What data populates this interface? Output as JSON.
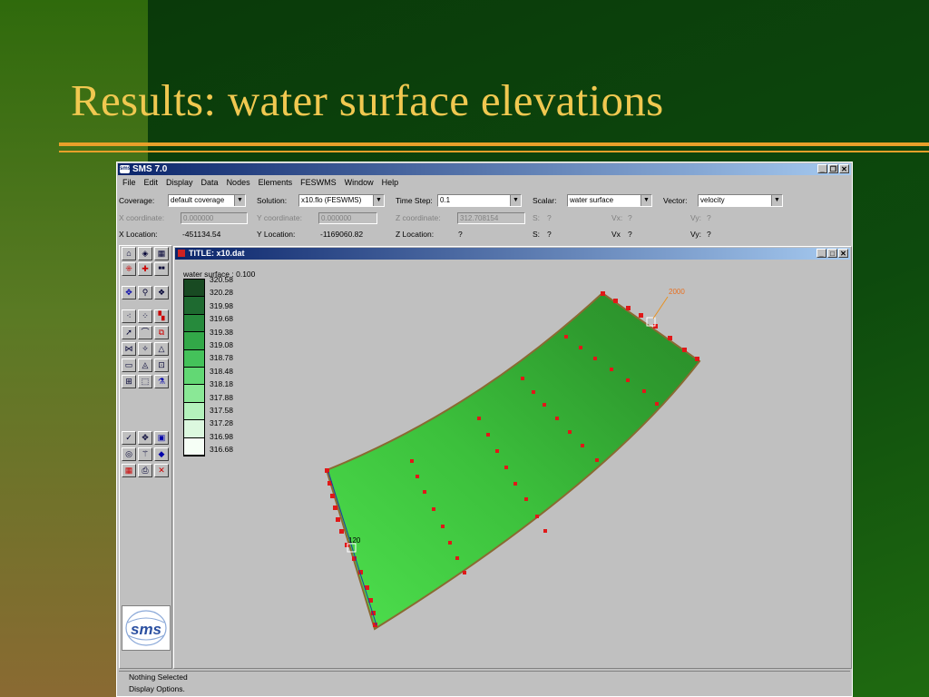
{
  "slide": {
    "title": "Results: water surface elevations"
  },
  "app": {
    "title": "SMS 7.0",
    "menu": [
      "File",
      "Edit",
      "Display",
      "Data",
      "Nodes",
      "Elements",
      "FESWMS",
      "Window",
      "Help"
    ],
    "toolbar": {
      "coverage_label": "Coverage:",
      "coverage_value": "default coverage",
      "solution_label": "Solution:",
      "solution_value": "x10.flo (FESWMS)",
      "timestep_label": "Time Step:",
      "timestep_value": "0.1",
      "scalar_label": "Scalar:",
      "scalar_value": "water surface",
      "vector_label": "Vector:",
      "vector_value": "velocity"
    },
    "coords": {
      "x_label": "X coordinate:",
      "x_value": "0.000000",
      "y_label": "Y coordinate:",
      "y_value": "0.000000",
      "z_label": "Z coordinate:",
      "z_value": "312.708154",
      "s_label": "S:",
      "s_value": "?",
      "vx_label": "Vx:",
      "vx_value": "?",
      "vy_label": "Vy:",
      "vy_value": "?"
    },
    "location": {
      "x_label": "X Location:",
      "x_value": "-451134.54",
      "y_label": "Y Location:",
      "y_value": "-1169060.82",
      "z_label": "Z Location:",
      "z_value": "?",
      "s_label": "S:",
      "s_value": "?",
      "vx_label": "Vx",
      "vx_value": "?",
      "vy_label": "Vy:",
      "vy_value": "?"
    },
    "child_window": {
      "title": "TITLE:  x10.dat"
    },
    "legend": {
      "title": "water surface : 0.100",
      "values": [
        "320.58",
        "320.28",
        "319.98",
        "319.68",
        "319.38",
        "319.08",
        "318.78",
        "318.48",
        "318.18",
        "317.88",
        "317.58",
        "317.28",
        "316.98",
        "316.68"
      ]
    },
    "plot_labels": {
      "upstream": "2000",
      "downstream": "120"
    },
    "logo_text": "sms",
    "status": {
      "line1": "Nothing Selected",
      "line2": "Display Options."
    }
  },
  "colors": {
    "slide_title": "#f0c850",
    "rule": "#e8a02a",
    "mesh_light": "#4ee04e",
    "mesh_dark": "#2e9a2e",
    "node": "#e01818"
  }
}
